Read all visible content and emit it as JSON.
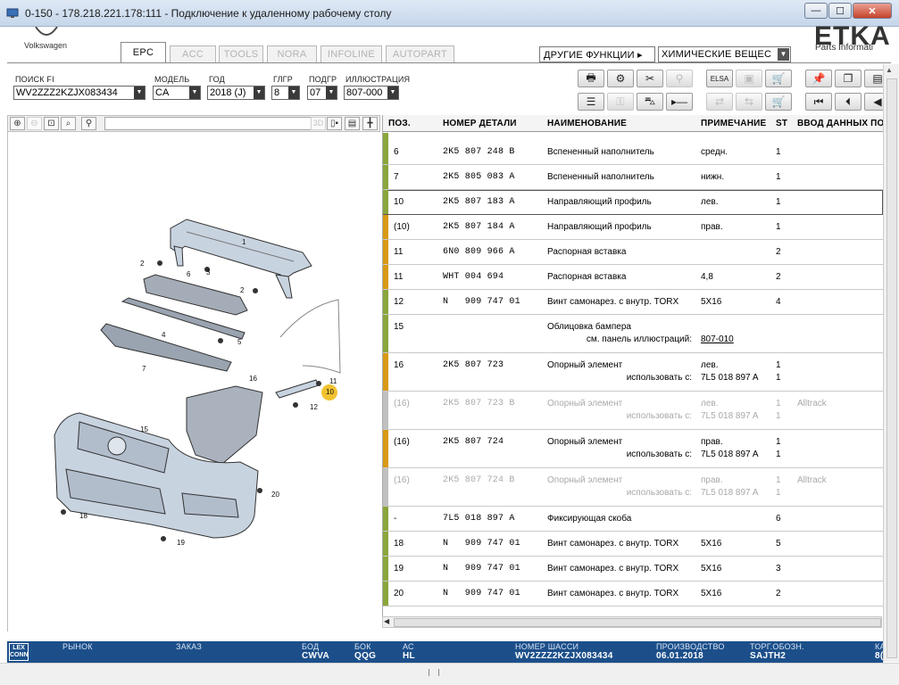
{
  "window": {
    "title": "0-150 - 178.218.221.178:111 - Подключение к удаленному рабочему столу",
    "minimize": "—",
    "maximize": "☐",
    "close": "✕"
  },
  "header": {
    "brand": "Volkswagen",
    "tabs": [
      {
        "label": "EPC",
        "active": true
      },
      {
        "label": "ACC",
        "active": false
      },
      {
        "label": "TOOLS",
        "active": false
      },
      {
        "label": "NORA",
        "active": false
      },
      {
        "label": "INFOLINE",
        "active": false
      },
      {
        "label": "AUTOPART",
        "active": false
      }
    ],
    "other_functions_label": "ДРУГИЕ ФУНКЦИИ ▸",
    "other_functions_value": "ХИМИЧЕСКИЕ ВЕЩЕС",
    "logo": "ETKA",
    "logo_sub": "Parts Informati"
  },
  "filters": {
    "search_label": "ПОИСК FI",
    "search_value": "WV2ZZZ2KZJX083434",
    "model_label": "МОДЕЛЬ",
    "model_value": "CA",
    "year_label": "ГОД",
    "year_value": "2018 (J)",
    "group_label": "ГЛГР",
    "group_value": "8",
    "subgroup_label": "ПОДГР",
    "subgroup_value": "07",
    "illustration_label": "ИЛЛЮСТРАЦИЯ",
    "illustration_value": "807-000"
  },
  "illustration_tools": {
    "mode_3d": "3D"
  },
  "illustration_callouts": [
    "1",
    "2",
    "2",
    "3",
    "4",
    "5",
    "6",
    "7",
    "10",
    "11",
    "12",
    "15",
    "16",
    "18",
    "19",
    "20"
  ],
  "table": {
    "columns": {
      "pos": "ПОЗ.",
      "part_no": "НОМЕР ДЕТАЛИ",
      "name": "НАИМЕНОВАНИЕ",
      "note": "ПРИМЕЧАНИЕ",
      "st": "ST",
      "input": "ВВОД ДАННЫХ ПО"
    },
    "rows": [
      {
        "pos": "6",
        "part": "2K5 807 248 B",
        "name": "Вспененный наполнитель",
        "note": "средн.",
        "st": "1",
        "extra": "",
        "grey": false,
        "sub_label": "",
        "sub_value": "",
        "sub_st": ""
      },
      {
        "pos": "7",
        "part": "2K5 805 083 A",
        "name": "Вспененный наполнитель",
        "note": "нижн.",
        "st": "1",
        "extra": "",
        "grey": false,
        "sub_label": "",
        "sub_value": "",
        "sub_st": ""
      },
      {
        "pos": "10",
        "part": "2K5 807 183 A",
        "name": "Направляющий профиль",
        "note": "лев.",
        "st": "1",
        "extra": "",
        "grey": false,
        "sub_label": "",
        "sub_value": "",
        "sub_st": ""
      },
      {
        "pos": "(10)",
        "part": "2K5 807 184 A",
        "name": "Направляющий профиль",
        "note": "прав.",
        "st": "1",
        "extra": "",
        "grey": false,
        "sub_label": "",
        "sub_value": "",
        "sub_st": ""
      },
      {
        "pos": "11",
        "part": "6N0 809 966 A",
        "name": "Распорная вставка",
        "note": "",
        "st": "2",
        "extra": "",
        "grey": false,
        "sub_label": "",
        "sub_value": "",
        "sub_st": ""
      },
      {
        "pos": "11",
        "part": "WHT 004 694",
        "name": "Распорная вставка",
        "note": "4,8",
        "st": "2",
        "extra": "",
        "grey": false,
        "sub_label": "",
        "sub_value": "",
        "sub_st": ""
      },
      {
        "pos": "12",
        "part": "N   909 747 01",
        "name": "Винт самонарез. с внутр. TORX",
        "note": "5X16",
        "st": "4",
        "extra": "",
        "grey": false,
        "sub_label": "",
        "sub_value": "",
        "sub_st": ""
      },
      {
        "pos": "15",
        "part": "",
        "name": "Облицовка бампера",
        "note": "",
        "st": "",
        "extra": "",
        "grey": false,
        "sub_label": "см. панель иллюстраций:",
        "sub_value": "807-010",
        "sub_st": "",
        "sub_link": true
      },
      {
        "pos": "16",
        "part": "2K5 807 723",
        "name": "Опорный элемент",
        "note": "лев.",
        "st": "1",
        "extra": "",
        "grey": false,
        "sub_label": "использовать с:",
        "sub_value": "7L5 018 897 A",
        "sub_st": "1"
      },
      {
        "pos": "(16)",
        "part": "2K5 807 723 B",
        "name": "Опорный элемент",
        "note": "лев.",
        "st": "1",
        "extra": "Alltrack",
        "grey": true,
        "sub_label": "использовать с:",
        "sub_value": "7L5 018 897 A",
        "sub_st": "1"
      },
      {
        "pos": "(16)",
        "part": "2K5 807 724",
        "name": "Опорный элемент",
        "note": "прав.",
        "st": "1",
        "extra": "",
        "grey": false,
        "sub_label": "использовать с:",
        "sub_value": "7L5 018 897 A",
        "sub_st": "1"
      },
      {
        "pos": "(16)",
        "part": "2K5 807 724 B",
        "name": "Опорный элемент",
        "note": "прав.",
        "st": "1",
        "extra": "Alltrack",
        "grey": true,
        "sub_label": "использовать с:",
        "sub_value": "7L5 018 897 A",
        "sub_st": "1"
      },
      {
        "pos": "-",
        "part": "7L5 018 897 A",
        "name": "Фиксирующая скоба",
        "note": "",
        "st": "6",
        "extra": "",
        "grey": false,
        "sub_label": "",
        "sub_value": "",
        "sub_st": ""
      },
      {
        "pos": "18",
        "part": "N   909 747 01",
        "name": "Винт самонарез. с внутр. TORX",
        "note": "5X16",
        "st": "5",
        "extra": "",
        "grey": false,
        "sub_label": "",
        "sub_value": "",
        "sub_st": ""
      },
      {
        "pos": "19",
        "part": "N   909 747 01",
        "name": "Винт самонарез. с внутр. TORX",
        "note": "5X16",
        "st": "3",
        "extra": "",
        "grey": false,
        "sub_label": "",
        "sub_value": "",
        "sub_st": ""
      },
      {
        "pos": "20",
        "part": "N   909 747 01",
        "name": "Винт самонарез. с внутр. TORX",
        "note": "5X16",
        "st": "2",
        "extra": "",
        "grey": false,
        "sub_label": "",
        "sub_value": "",
        "sub_st": ""
      }
    ],
    "bar_colors": {
      "green": "#8aa63c",
      "orange": "#d89a14",
      "grey": "#c0c0c0"
    }
  },
  "status": {
    "logo": "LEX CONN",
    "market_label": "РЫНОК",
    "order_label": "ЗАКАЗ",
    "body_label": "БОД",
    "body_value": "CWVA",
    "box_label": "БОК",
    "box_value": "QQG",
    "ac_label": "АС",
    "ac_value": "HL",
    "chassis_label": "НОМЕР ШАССИ",
    "chassis_value": "WV2ZZZ2KZJX083434",
    "production_label": "ПРОИЗВОДСТВО",
    "production_value": "06.01.2018",
    "trade_label": "ТОРГ.ОБОЗН.",
    "trade_value": "SAJTH2",
    "ka_label": "КА",
    "ka_value": "8("
  },
  "colors": {
    "status_bg": "#1c4f8a",
    "callout_highlight": "#f2c230"
  }
}
